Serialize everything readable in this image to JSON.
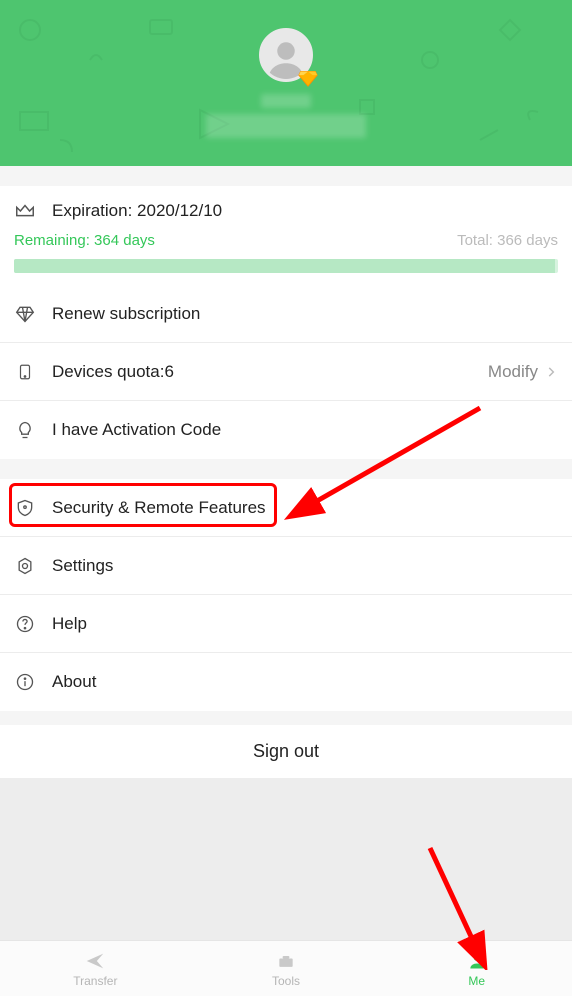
{
  "header": {
    "avatar_alt": "user-avatar"
  },
  "expiration": {
    "label_prefix": "Expiration: ",
    "date": "2020/12/10",
    "remaining": "Remaining: 364 days",
    "total": "Total: 366 days"
  },
  "subscription": {
    "renew": "Renew subscription",
    "devices_quota": "Devices quota:6",
    "modify": "Modify",
    "activation": "I have Activation Code"
  },
  "menu": {
    "security": "Security & Remote Features",
    "settings": "Settings",
    "help": "Help",
    "about": "About"
  },
  "signout": "Sign out",
  "nav": {
    "transfer": "Transfer",
    "tools": "Tools",
    "me": "Me"
  }
}
